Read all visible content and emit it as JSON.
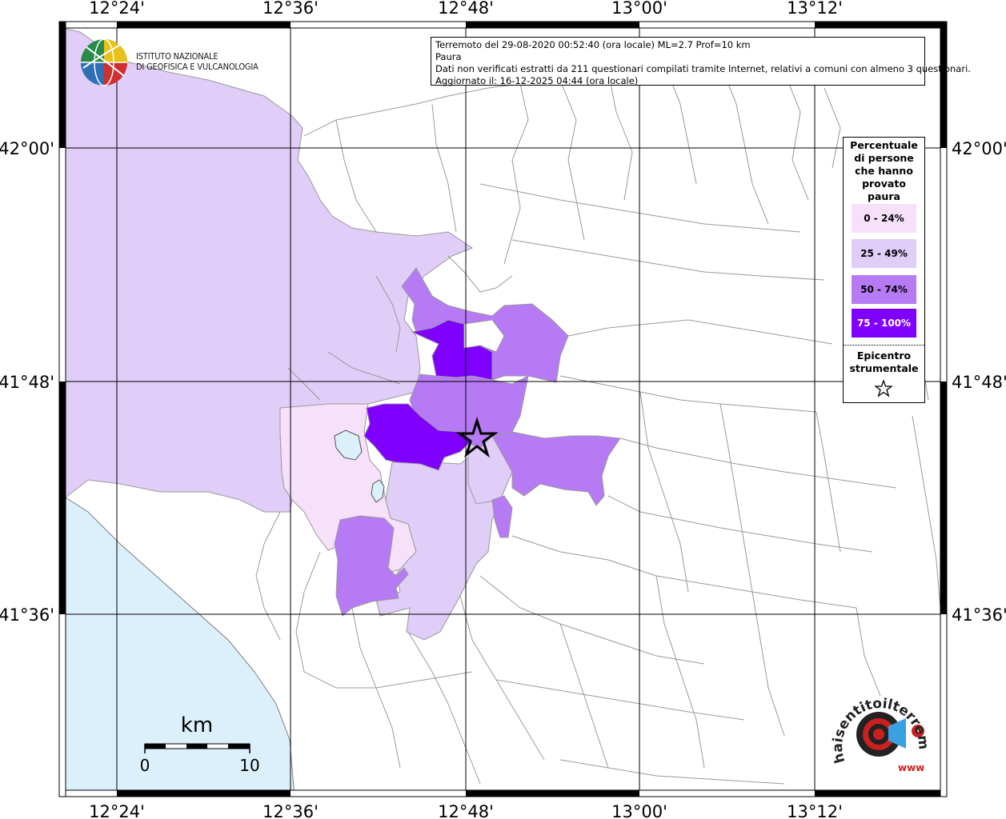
{
  "map": {
    "lon_ticks": [
      "12°24'",
      "12°36'",
      "12°48'",
      "13°00'",
      "13°12'"
    ],
    "lat_ticks": [
      "42°00'",
      "41°48'",
      "41°36'"
    ],
    "colors": {
      "sea": "#dcf0fb",
      "class_0_24": "#f6e0fa",
      "class_25_49": "#e0cdf8",
      "class_50_74": "#b67af5",
      "class_75_100": "#8000ff",
      "boundary": "#9a9a9a"
    }
  },
  "info": {
    "line1": "Terremoto del 29-08-2020 00:52:40 (ora locale) ML=2.7 Prof=10 km",
    "line2": "Paura",
    "line3": "Dati non verificati estratti da 211 questionari compilati tramite Internet, relativi a comuni con almeno 3 questionari.",
    "line4": "Aggiornato il: 16-12-2025 04:44 (ora locale)"
  },
  "legend": {
    "title": [
      "Percentuale",
      "di persone",
      "che hanno",
      "provato",
      "paura"
    ],
    "items": [
      {
        "label": "0 - 24%",
        "color": "#f6e0fa"
      },
      {
        "label": "25 - 49%",
        "color": "#e0cdf8"
      },
      {
        "label": "50 - 74%",
        "color": "#b67af5"
      },
      {
        "label": "75 - 100%",
        "color": "#8000ff"
      }
    ],
    "epicenter_label": [
      "Epicentro",
      "strumentale"
    ],
    "epicenter_icon": "star-outline-icon"
  },
  "scale": {
    "unit": "km",
    "start": "0",
    "end": "10"
  },
  "logos": {
    "ingv_line1": "ISTITUTO NAZIONALE",
    "ingv_line2": "DI GEOFISICA E VULCANOLOGIA",
    "hsit_text": "haisentitoilterremoto.it",
    "hsit_url": "www"
  }
}
